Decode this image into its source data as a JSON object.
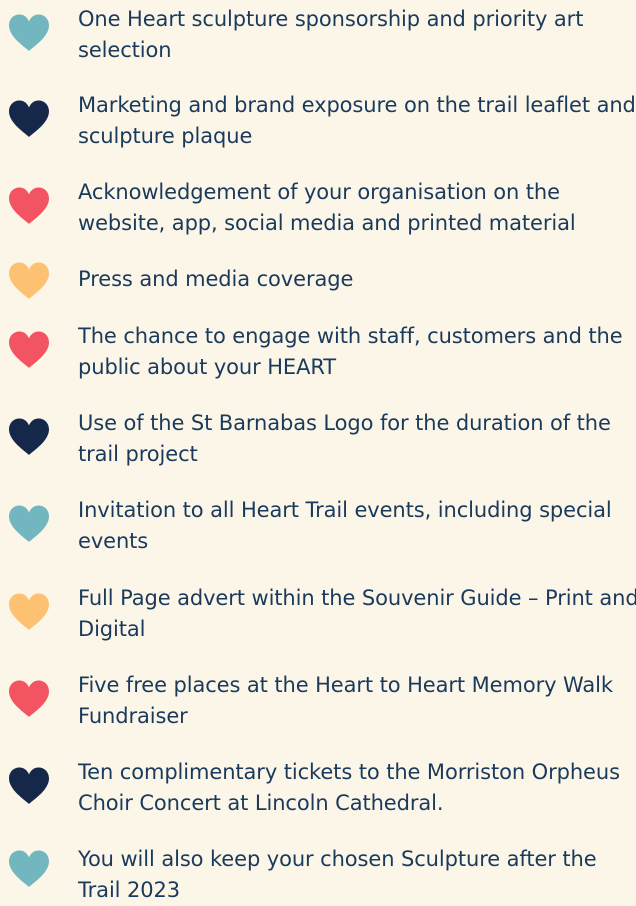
{
  "benefits": [
    {
      "text": "One Heart sculpture sponsorship and priority art selection",
      "color": "#72b7c0",
      "icon": "heart-icon"
    },
    {
      "text": "Marketing and brand exposure on the trail leaflet and sculpture plaque",
      "color": "#16284a",
      "icon": "heart-icon"
    },
    {
      "text": "Acknowledgement of your organisation on the website, app, social media and printed material",
      "color": "#f25462",
      "icon": "heart-icon"
    },
    {
      "text": "Press and media coverage",
      "color": "#fdc172",
      "icon": "heart-icon"
    },
    {
      "text": "The chance to engage with staff, customers and the public about your HEART",
      "color": "#f25462",
      "icon": "heart-icon"
    },
    {
      "text": "Use of the St Barnabas Logo for the duration of the trail project",
      "color": "#16284a",
      "icon": "heart-icon"
    },
    {
      "text": "Invitation to all Heart Trail events, including special events",
      "color": "#72b7c0",
      "icon": "heart-icon"
    },
    {
      "text": "Full Page advert within the Souvenir Guide – Print and Digital",
      "color": "#fdc172",
      "icon": "heart-icon"
    },
    {
      "text": "Five free places at the Heart to Heart Memory Walk Fundraiser",
      "color": "#f25462",
      "icon": "heart-icon"
    },
    {
      "text": "Ten complimentary tickets to the Morriston Orpheus Choir Concert at Lincoln Cathedral.",
      "color": "#16284a",
      "icon": "heart-icon"
    },
    {
      "text": "You will also keep your chosen Sculpture after the Trail 2023",
      "color": "#72b7c0",
      "icon": "heart-icon"
    }
  ]
}
